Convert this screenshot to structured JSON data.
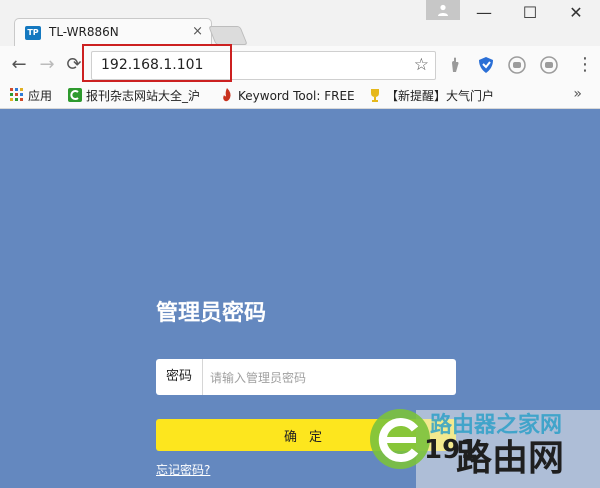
{
  "tab": {
    "favicon_text": "TP",
    "title": "TL-WR886N",
    "close_glyph": "×"
  },
  "window_controls": {
    "minimize": "—",
    "maximize": "☐",
    "close": "✕"
  },
  "toolbar": {
    "back": "←",
    "forward": "→",
    "reload": "⟳",
    "url": "192.168.1.101",
    "menu": "⋮"
  },
  "bookmarks": [
    {
      "label": "应用",
      "icon": "apps-grid-icon",
      "color": "#d04a2a"
    },
    {
      "label": "报刊杂志网站大全_沪",
      "icon": "green-c-icon",
      "color": "#2e9a2e"
    },
    {
      "label": "Keyword Tool: FREE",
      "icon": "flame-icon",
      "color": "#c8321e"
    },
    {
      "label": "【新提醒】大气门户",
      "icon": "trophy-icon",
      "color": "#e6b81c"
    }
  ],
  "bookmarks_more": "»",
  "page": {
    "background": "#6488bf",
    "heading": "管理员密码",
    "password_label": "密码",
    "password_placeholder": "请输入管理员密码",
    "confirm_label": "确定",
    "forgot_link": "忘记密码?"
  },
  "watermark": {
    "top_text": "路由器之家网",
    "big_text": "路由网",
    "digits": "191"
  }
}
